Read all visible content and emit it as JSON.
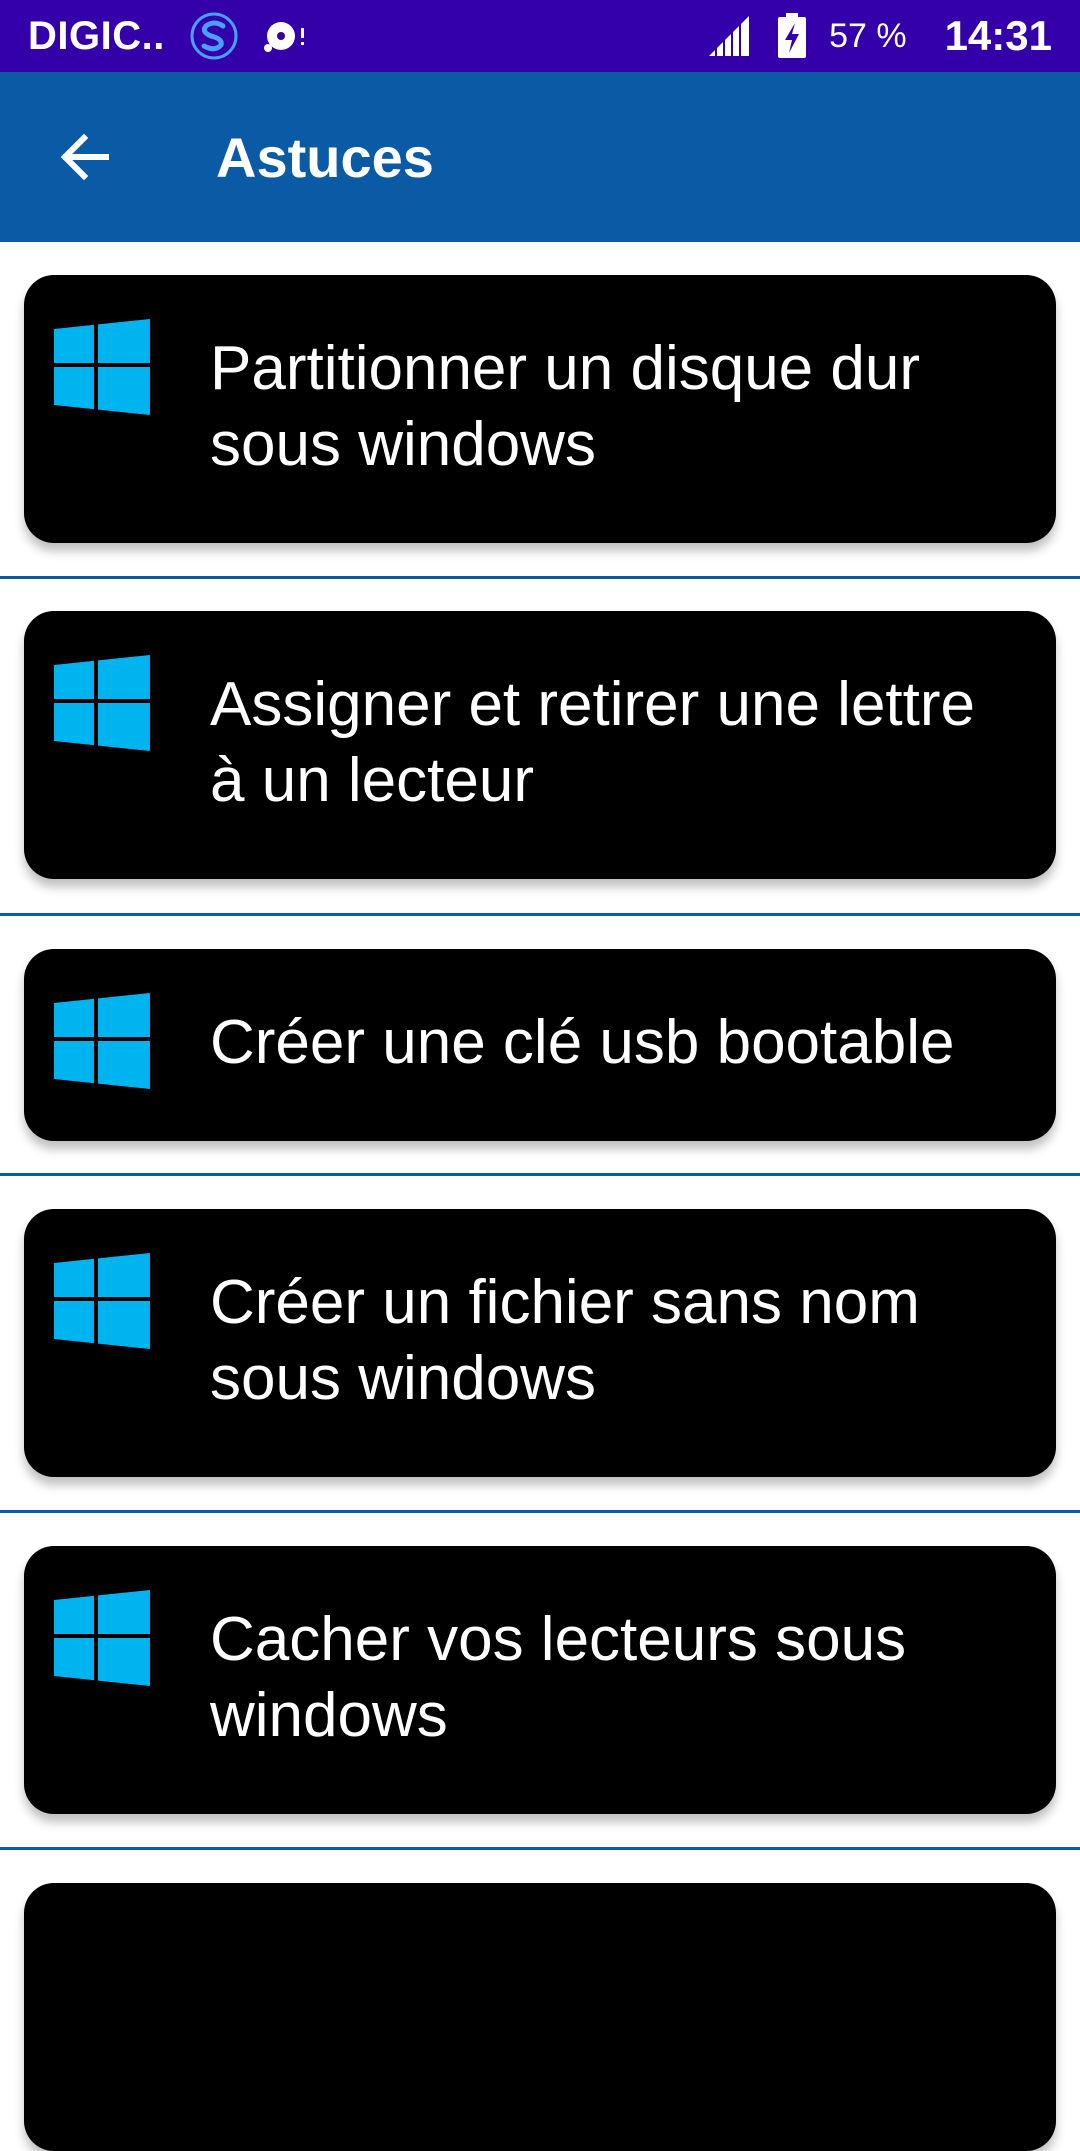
{
  "status_bar": {
    "carrier": "DIGIC..",
    "battery": "57 %",
    "time": "14:31",
    "icons": [
      "s-app-icon",
      "media-notification-icon",
      "signal-icon",
      "battery-charging-icon"
    ]
  },
  "app_bar": {
    "title": "Astuces",
    "back_icon": "arrow-back-icon",
    "color": "#0b5aa6"
  },
  "items": [
    {
      "title": "Partitionner un disque dur sous windows",
      "icon": "windows-logo-icon"
    },
    {
      "title": "Assigner et retirer une lettre à un lecteur",
      "icon": "windows-logo-icon"
    },
    {
      "title": "Créer une clé usb bootable",
      "icon": "windows-logo-icon"
    },
    {
      "title": "Créer un fichier sans nom sous windows",
      "icon": "windows-logo-icon"
    },
    {
      "title": "Cacher vos lecteurs sous windows",
      "icon": "windows-logo-icon"
    },
    {
      "title": "",
      "icon": "windows-logo-icon"
    }
  ],
  "colors": {
    "status_bar": "#3300aa",
    "card": "#000000",
    "icon": "#00b4f0",
    "divider": "#0b5aa6"
  }
}
